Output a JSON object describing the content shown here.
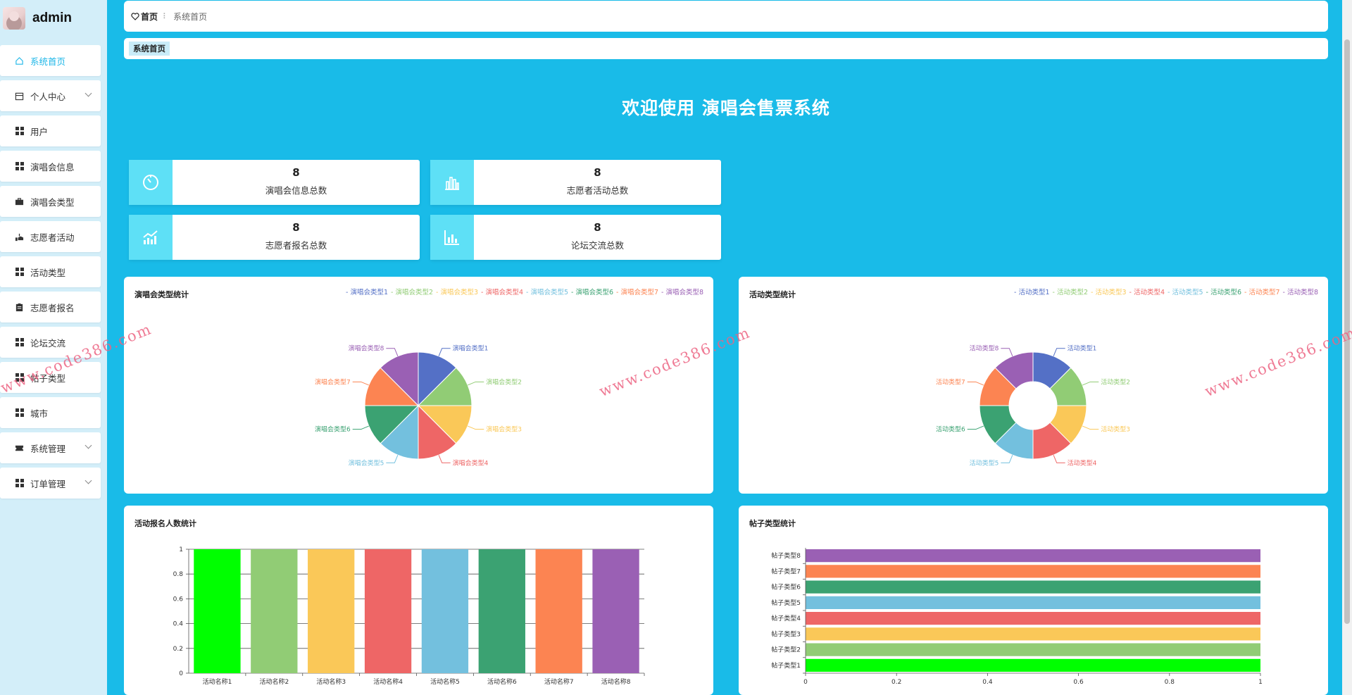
{
  "user": {
    "name": "admin"
  },
  "sidebar": {
    "items": [
      {
        "label": "系统首页",
        "icon": "home-icon",
        "active": true,
        "expandable": false
      },
      {
        "label": "个人中心",
        "icon": "calendar-icon",
        "expandable": true
      },
      {
        "label": "用户",
        "icon": "grid-icon",
        "expandable": false
      },
      {
        "label": "演唱会信息",
        "icon": "grid-icon",
        "expandable": false
      },
      {
        "label": "演唱会类型",
        "icon": "briefcase-icon",
        "expandable": false
      },
      {
        "label": "志愿者活动",
        "icon": "hand-icon",
        "expandable": false
      },
      {
        "label": "活动类型",
        "icon": "grid-icon",
        "expandable": false
      },
      {
        "label": "志愿者报名",
        "icon": "clipboard-icon",
        "expandable": false
      },
      {
        "label": "论坛交流",
        "icon": "grid-icon",
        "expandable": false
      },
      {
        "label": "帖子类型",
        "icon": "grid-icon",
        "expandable": false
      },
      {
        "label": "城市",
        "icon": "grid-icon",
        "expandable": false
      },
      {
        "label": "系统管理",
        "icon": "ticket-icon",
        "expandable": true
      },
      {
        "label": "订单管理",
        "icon": "grid-icon",
        "expandable": true
      }
    ]
  },
  "breadcrumb": {
    "home": "首页",
    "current": "系统首页"
  },
  "tabs": [
    {
      "label": "系统首页"
    }
  ],
  "welcome": "欢迎使用 演唱会售票系统",
  "stats": [
    {
      "value": "8",
      "label": "演唱会信息总数",
      "icon": "timer-icon"
    },
    {
      "value": "8",
      "label": "志愿者活动总数",
      "icon": "bar-chart-icon"
    },
    {
      "value": "8",
      "label": "志愿者报名总数",
      "icon": "trend-chart-icon"
    },
    {
      "value": "8",
      "label": "论坛交流总数",
      "icon": "column-chart-icon"
    }
  ],
  "watermark": "www.code386.com",
  "colors": {
    "accent": "#19bbe8",
    "sidebar_bg": "#d3eef9",
    "stat_icon_bg": "#5ee0f6",
    "palette": [
      "#5470c6",
      "#91cc75",
      "#fac858",
      "#ee6666",
      "#73c0de",
      "#3ba272",
      "#fc8452",
      "#9a60b4"
    ],
    "first_bar": "#00ff00"
  },
  "chart_data": [
    {
      "type": "pie",
      "title": "演唱会类型统计",
      "categories": [
        "演唱会类型1",
        "演唱会类型2",
        "演唱会类型3",
        "演唱会类型4",
        "演唱会类型5",
        "演唱会类型6",
        "演唱会类型7",
        "演唱会类型8"
      ],
      "values": [
        1,
        1,
        1,
        1,
        1,
        1,
        1,
        1
      ],
      "legend": "top-right",
      "donut": false
    },
    {
      "type": "pie",
      "title": "活动类型统计",
      "categories": [
        "活动类型1",
        "活动类型2",
        "活动类型3",
        "活动类型4",
        "活动类型5",
        "活动类型6",
        "活动类型7",
        "活动类型8"
      ],
      "values": [
        1,
        1,
        1,
        1,
        1,
        1,
        1,
        1
      ],
      "legend": "top-right",
      "donut": true
    },
    {
      "type": "bar",
      "title": "活动报名人数统计",
      "categories": [
        "活动名称1",
        "活动名称2",
        "活动名称3",
        "活动名称4",
        "活动名称5",
        "活动名称6",
        "活动名称7",
        "活动名称8"
      ],
      "values": [
        1,
        1,
        1,
        1,
        1,
        1,
        1,
        1
      ],
      "ylim": [
        0,
        1
      ],
      "yticks": [
        "0",
        "0.2",
        "0.4",
        "0.6",
        "0.8",
        "1"
      ],
      "grid": true
    },
    {
      "type": "bar",
      "orientation": "horizontal",
      "title": "帖子类型统计",
      "categories": [
        "帖子类型1",
        "帖子类型2",
        "帖子类型3",
        "帖子类型4",
        "帖子类型5",
        "帖子类型6",
        "帖子类型7",
        "帖子类型8"
      ],
      "values": [
        1,
        1,
        1,
        1,
        1,
        1,
        1,
        1
      ],
      "xlim": [
        0,
        1
      ],
      "xticks": [
        "0",
        "0.2",
        "0.4",
        "0.6",
        "0.8",
        "1"
      ]
    }
  ]
}
